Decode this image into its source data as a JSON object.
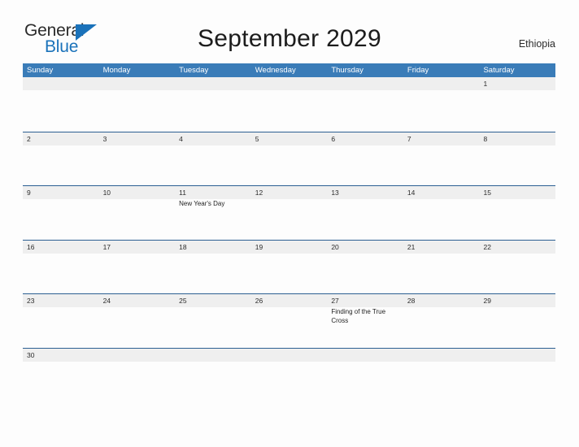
{
  "brand": {
    "name_part1": "General",
    "name_part2": "Blue",
    "flag_icon": "triangle-flag-icon",
    "color_dark": "#2b2b2b",
    "color_blue": "#1a72ba"
  },
  "header": {
    "title": "September 2029",
    "locale": "Ethiopia"
  },
  "colors": {
    "header_blue": "#3a7cb8",
    "divider_blue": "#2c5f92",
    "day_band_gray": "#efefef",
    "page_background": "#fdfdfd"
  },
  "calendar": {
    "month": "September",
    "year": "2029",
    "weekday_headers": [
      "Sunday",
      "Monday",
      "Tuesday",
      "Wednesday",
      "Thursday",
      "Friday",
      "Saturday"
    ],
    "weeks": [
      {
        "days": [
          {
            "num": "",
            "events": []
          },
          {
            "num": "",
            "events": []
          },
          {
            "num": "",
            "events": []
          },
          {
            "num": "",
            "events": []
          },
          {
            "num": "",
            "events": []
          },
          {
            "num": "",
            "events": []
          },
          {
            "num": "1",
            "events": []
          }
        ]
      },
      {
        "days": [
          {
            "num": "2",
            "events": []
          },
          {
            "num": "3",
            "events": []
          },
          {
            "num": "4",
            "events": []
          },
          {
            "num": "5",
            "events": []
          },
          {
            "num": "6",
            "events": []
          },
          {
            "num": "7",
            "events": []
          },
          {
            "num": "8",
            "events": []
          }
        ]
      },
      {
        "days": [
          {
            "num": "9",
            "events": []
          },
          {
            "num": "10",
            "events": []
          },
          {
            "num": "11",
            "events": [
              "New Year's Day"
            ]
          },
          {
            "num": "12",
            "events": []
          },
          {
            "num": "13",
            "events": []
          },
          {
            "num": "14",
            "events": []
          },
          {
            "num": "15",
            "events": []
          }
        ]
      },
      {
        "days": [
          {
            "num": "16",
            "events": []
          },
          {
            "num": "17",
            "events": []
          },
          {
            "num": "18",
            "events": []
          },
          {
            "num": "19",
            "events": []
          },
          {
            "num": "20",
            "events": []
          },
          {
            "num": "21",
            "events": []
          },
          {
            "num": "22",
            "events": []
          }
        ]
      },
      {
        "days": [
          {
            "num": "23",
            "events": []
          },
          {
            "num": "24",
            "events": []
          },
          {
            "num": "25",
            "events": []
          },
          {
            "num": "26",
            "events": []
          },
          {
            "num": "27",
            "events": [
              "Finding of the True Cross"
            ]
          },
          {
            "num": "28",
            "events": []
          },
          {
            "num": "29",
            "events": []
          }
        ]
      },
      {
        "days": [
          {
            "num": "30",
            "events": []
          },
          {
            "num": "",
            "events": []
          },
          {
            "num": "",
            "events": []
          },
          {
            "num": "",
            "events": []
          },
          {
            "num": "",
            "events": []
          },
          {
            "num": "",
            "events": []
          },
          {
            "num": "",
            "events": []
          }
        ]
      }
    ]
  }
}
